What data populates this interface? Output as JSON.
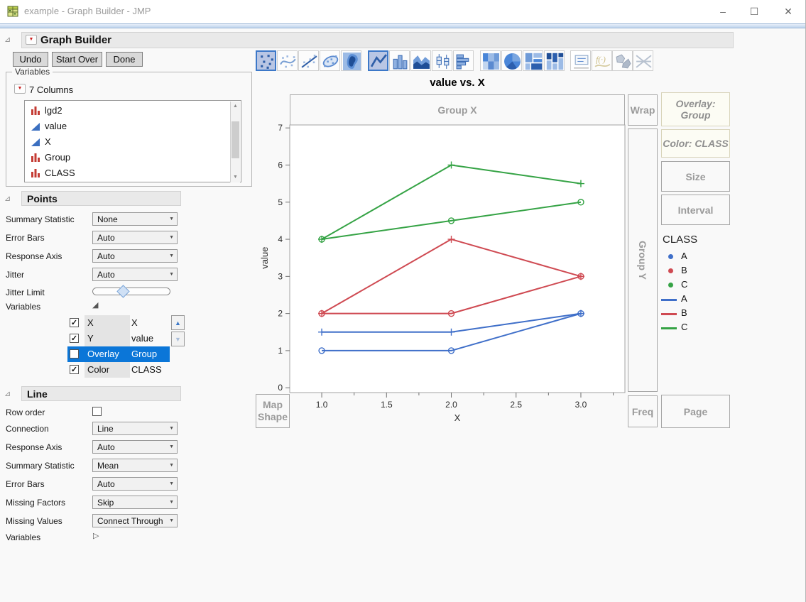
{
  "window": {
    "title": "example - Graph Builder - JMP"
  },
  "icons": {
    "disclosure": "⊿",
    "red_triangle": "▼",
    "expanded_triangle": "◢",
    "collapsed_triangle": "▷",
    "check": "✓",
    "dropdown_arrow": "▼",
    "scroll_up": "▲",
    "scroll_down": "▼",
    "spin_up": "▲",
    "spin_down": "▼",
    "minimize": "–",
    "maximize": "☐",
    "close": "✕"
  },
  "header": {
    "title": "Graph Builder",
    "undo": "Undo",
    "start_over": "Start Over",
    "done": "Done"
  },
  "toolbar": {
    "icon_names": [
      "points",
      "smoother",
      "line-of-fit",
      "ellipse",
      "contour-density",
      "line",
      "bar",
      "area",
      "box-plot",
      "histogram",
      "heatmap",
      "pie",
      "treemap",
      "mosaic",
      "caption-box",
      "formula",
      "map-shapes",
      "parallel-plot"
    ],
    "selected": [
      "points",
      "line"
    ]
  },
  "variables_panel": {
    "group_title": "Variables",
    "columns_label": "7 Columns",
    "columns": [
      {
        "name": "lgd2",
        "type": "nominal"
      },
      {
        "name": "value",
        "type": "continuous"
      },
      {
        "name": "X",
        "type": "continuous"
      },
      {
        "name": "Group",
        "type": "nominal"
      },
      {
        "name": "CLASS",
        "type": "nominal"
      }
    ]
  },
  "points_panel": {
    "title": "Points",
    "rows": [
      {
        "label": "Summary Statistic",
        "value": "None"
      },
      {
        "label": "Error Bars",
        "value": "Auto"
      },
      {
        "label": "Response Axis",
        "value": "Auto"
      },
      {
        "label": "Jitter",
        "value": "Auto"
      }
    ],
    "jitter_limit_label": "Jitter Limit",
    "variables_label": "Variables",
    "roles": [
      {
        "checked": true,
        "role": "X",
        "value": "X",
        "selected": false
      },
      {
        "checked": true,
        "role": "Y",
        "value": "value",
        "selected": false
      },
      {
        "checked": false,
        "role": "Overlay",
        "value": "Group",
        "selected": true
      },
      {
        "checked": true,
        "role": "Color",
        "value": "CLASS",
        "selected": false
      }
    ]
  },
  "line_panel": {
    "title": "Line",
    "row_order_label": "Row order",
    "row_order_checked": false,
    "rows": [
      {
        "label": "Connection",
        "value": "Line"
      },
      {
        "label": "Response Axis",
        "value": "Auto"
      },
      {
        "label": "Summary Statistic",
        "value": "Mean"
      },
      {
        "label": "Error Bars",
        "value": "Auto"
      },
      {
        "label": "Missing Factors",
        "value": "Skip"
      },
      {
        "label": "Missing Values",
        "value": "Connect Through"
      }
    ],
    "variables_label": "Variables"
  },
  "graph": {
    "title": "value vs. X",
    "zones": {
      "group_x": "Group X",
      "wrap": "Wrap",
      "overlay": "Overlay: Group",
      "color": "Color: CLASS",
      "size": "Size",
      "interval": "Interval",
      "group_y": "Group Y",
      "map_shape": "Map Shape",
      "freq": "Freq",
      "page": "Page"
    },
    "legend": {
      "title": "CLASS",
      "point_items": [
        {
          "label": "A",
          "color": "#3f6fc9"
        },
        {
          "label": "B",
          "color": "#cf4a52"
        },
        {
          "label": "C",
          "color": "#35a345"
        }
      ],
      "line_items": [
        {
          "label": "A",
          "color": "#3f6fc9"
        },
        {
          "label": "B",
          "color": "#cf4a52"
        },
        {
          "label": "C",
          "color": "#35a345"
        }
      ]
    }
  },
  "chart_data": {
    "type": "line",
    "title": "value vs. X",
    "xlabel": "X",
    "ylabel": "value",
    "xlim": [
      0.753,
      3.34
    ],
    "ylim": [
      -0.13,
      7.08
    ],
    "xticks": [
      1,
      1.5,
      2,
      2.5,
      3
    ],
    "xtick_labels": [
      "1.0",
      "1.5",
      "2.0",
      "2.5",
      "3.0"
    ],
    "x_minor_ticks": [
      1.25,
      1.75,
      2.25,
      2.75,
      3.25
    ],
    "yticks": [
      0,
      1,
      2,
      3,
      4,
      5,
      6,
      7
    ],
    "grid": false,
    "legend_position": "right",
    "x": [
      1,
      2,
      3
    ],
    "series": [
      {
        "name": "A",
        "marker": "circle",
        "color": "#3f6fc9",
        "values": [
          1,
          1,
          2
        ]
      },
      {
        "name": "A",
        "marker": "plus",
        "color": "#3f6fc9",
        "values": [
          1.5,
          1.5,
          2
        ]
      },
      {
        "name": "B",
        "marker": "circle",
        "color": "#cf4a52",
        "values": [
          2,
          2,
          3
        ]
      },
      {
        "name": "B",
        "marker": "plus",
        "color": "#cf4a52",
        "values": [
          2,
          4,
          3
        ]
      },
      {
        "name": "C",
        "marker": "circle",
        "color": "#35a345",
        "values": [
          4,
          4.5,
          5
        ]
      },
      {
        "name": "C",
        "marker": "plus",
        "color": "#35a345",
        "values": [
          4,
          6,
          5.5
        ]
      }
    ]
  }
}
